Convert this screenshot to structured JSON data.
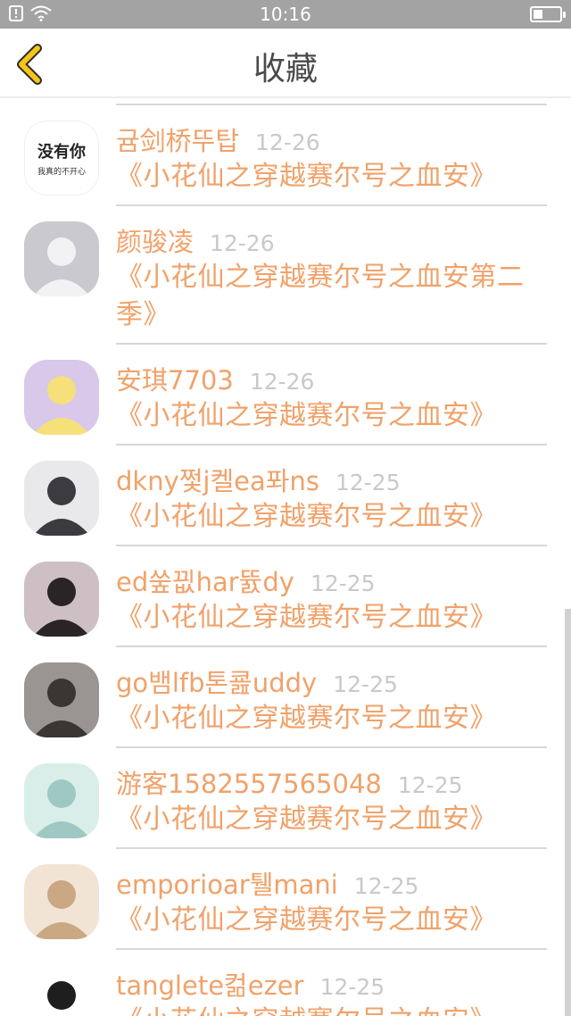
{
  "status_bar": {
    "time": "10:16"
  },
  "header": {
    "title": "收藏",
    "back_icon": "chevron-left-icon",
    "accent": "#f5c518"
  },
  "colors": {
    "name": "#f0a26a",
    "date": "#c9c9c9",
    "divider": "#d7d7d7"
  },
  "items": [
    {
      "name": "귬剑桥뚜탑",
      "date": "12-26",
      "book": "《小花仙之穿越赛尔号之血安》",
      "avatar": {
        "kind": "text",
        "line1": "没有你",
        "line2": "我真的不开心"
      }
    },
    {
      "name": "颜骏凌",
      "date": "12-26",
      "book": "《小花仙之穿越赛尔号之血安第二季》",
      "avatar": {
        "kind": "photo",
        "bg": "#c9c9cf",
        "fg": "#f2f2f4"
      }
    },
    {
      "name": "安琪7703",
      "date": "12-26",
      "book": "《小花仙之穿越赛尔号之血安》",
      "avatar": {
        "kind": "photo",
        "bg": "#d9c8ea",
        "fg": "#f6e07a"
      }
    },
    {
      "name": "dkny쩣j켈ea퐈ns",
      "date": "12-25",
      "book": "《小花仙之穿越赛尔号之血安》",
      "avatar": {
        "kind": "photo",
        "bg": "#e9e9ec",
        "fg": "#3b3b40"
      }
    },
    {
      "name": "ed쑾끲har뜘dy",
      "date": "12-25",
      "book": "《小花仙之穿越赛尔号之血安》",
      "avatar": {
        "kind": "photo",
        "bg": "#cdbfc3",
        "fg": "#2a2426"
      }
    },
    {
      "name": "go뱀lfb톤쿒uddy",
      "date": "12-25",
      "book": "《小花仙之穿越赛尔号之血安》",
      "avatar": {
        "kind": "photo",
        "bg": "#9a9592",
        "fg": "#3a3634"
      }
    },
    {
      "name": "游客1582557565048",
      "date": "12-25",
      "book": "《小花仙之穿越赛尔号之血安》",
      "avatar": {
        "kind": "photo",
        "bg": "#d9eee9",
        "fg": "#9fc8c4"
      }
    },
    {
      "name": "emporioar퉬mani",
      "date": "12-25",
      "book": "《小花仙之穿越赛尔号之血安》",
      "avatar": {
        "kind": "photo",
        "bg": "#f1e4d4",
        "fg": "#c9a883"
      }
    },
    {
      "name": "tanglete컮ezer",
      "date": "12-25",
      "book": "《小花仙之穿越赛尔号之血安》",
      "avatar": {
        "kind": "photo",
        "bg": "#ffffff",
        "fg": "#1e1e1e"
      }
    }
  ]
}
